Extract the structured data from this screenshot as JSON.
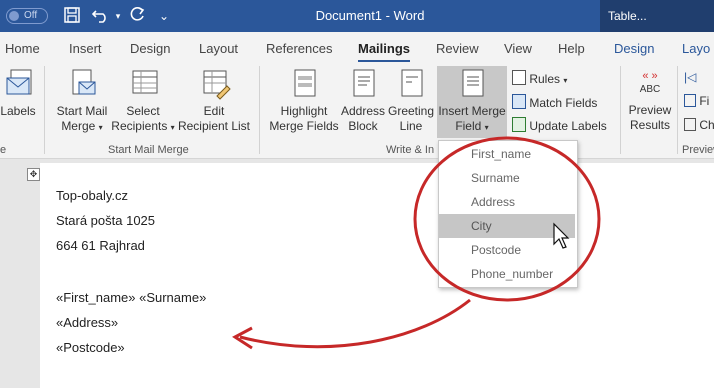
{
  "titlebar": {
    "autosave": "Off",
    "doc_title": "Document1  -  Word",
    "context_title": "Table..."
  },
  "tabs": [
    "Home",
    "Insert",
    "Design",
    "Layout",
    "References",
    "Mailings",
    "Review",
    "View",
    "Help",
    "Design",
    "Layo"
  ],
  "ribbon": {
    "labels_btn": "Labels",
    "start_merge": [
      "Start Mail",
      "Merge"
    ],
    "select_recipients": [
      "Select",
      "Recipients"
    ],
    "edit_recipient": [
      "Edit",
      "Recipient List"
    ],
    "group_start": "Start Mail Merge",
    "highlight": [
      "Highlight",
      "Merge Fields"
    ],
    "address_block": [
      "Address",
      "Block"
    ],
    "greeting_line": [
      "Greeting",
      "Line"
    ],
    "insert_merge": [
      "Insert Merge",
      "Field"
    ],
    "rules": "Rules",
    "match_fields": "Match Fields",
    "update_labels": "Update Labels",
    "group_write": "Write & In",
    "preview_results": [
      "Preview",
      "Results"
    ],
    "abc": "ABC",
    "group_preview": "Preview",
    "fi": "Fi",
    "ch": "Ch",
    "group_left": "e"
  },
  "menu": {
    "items": [
      "First_name",
      "Surname",
      "Address",
      "City",
      "Postcode",
      "Phone_number"
    ],
    "highlighted": "City"
  },
  "document": {
    "lines": [
      "Top-obaly.cz",
      "Stará pošta 1025",
      "664 61 Rajhrad",
      "«First_name» «Surname»",
      "«Address»",
      "«Postcode»"
    ]
  },
  "colors": {
    "word_blue": "#2b579a",
    "annotation_red": "#c62828"
  }
}
